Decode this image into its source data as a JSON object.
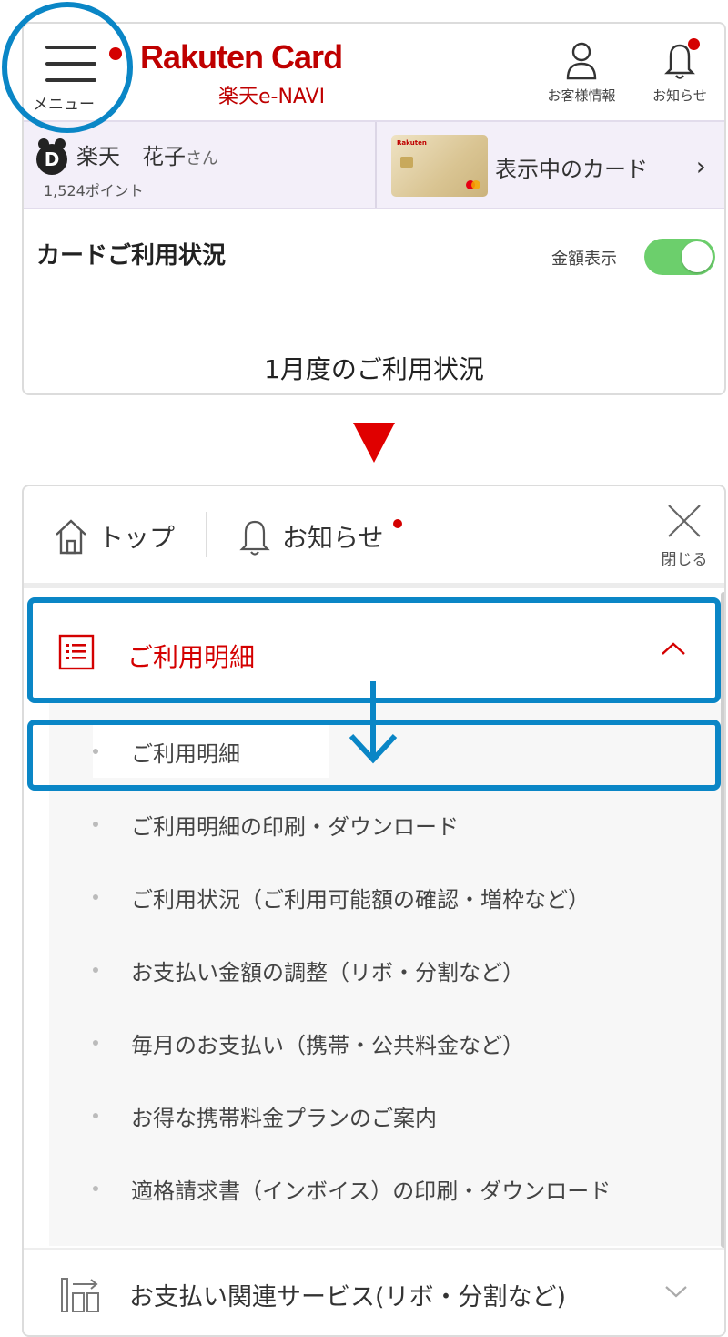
{
  "header": {
    "menu_label": "メニュー",
    "brand": "Rakuten Card",
    "brand_sub": "楽天e-NAVI",
    "customer_label": "お客様情報",
    "notice_label": "お知らせ",
    "accent_color": "#bf0000"
  },
  "user": {
    "rank_icon": "D",
    "name": "楽天　花子",
    "honorific": "さん",
    "points": "1,524ポイント"
  },
  "card": {
    "label": "表示中のカード"
  },
  "usage": {
    "title": "カードご利用状況",
    "amount_toggle_label": "金額表示",
    "amount_toggle_on": true,
    "month_text": "1月度のご利用状況"
  },
  "menu": {
    "top_label": "トップ",
    "news_label": "お知らせ",
    "close_label": "閉じる",
    "section": {
      "title": "ご利用明細",
      "expanded": true
    },
    "items": [
      "ご利用明細",
      "ご利用明細の印刷・ダウンロード",
      "ご利用状況（ご利用可能額の確認・増枠など）",
      "お支払い金額の調整（リボ・分割など）",
      "毎月のお支払い（携帯・公共料金など）",
      "お得な携帯料金プランのご案内",
      "適格請求書（インボイス）の印刷・ダウンロード"
    ],
    "bottom_item": "お支払い関連サービス(リボ・分割など)"
  },
  "annotation": {
    "highlight_color": "#0a86c6",
    "arrow_color": "#e00000"
  }
}
